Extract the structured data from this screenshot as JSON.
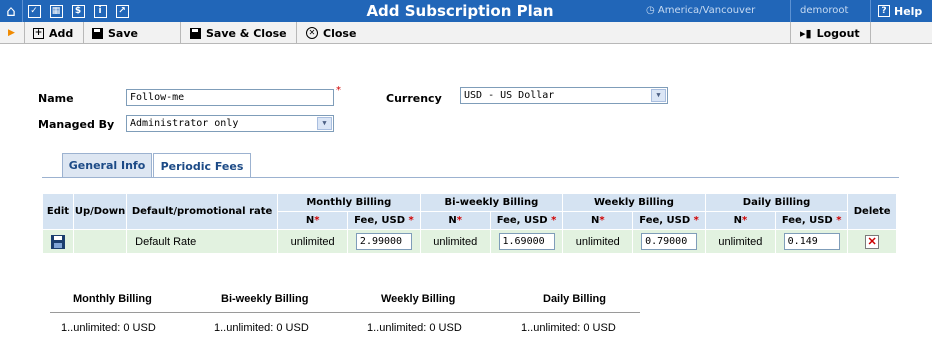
{
  "header": {
    "title": "Add Subscription Plan",
    "timezone": "America/Vancouver",
    "user": "demoroot",
    "help_label": "Help",
    "icons": [
      "home-icon",
      "checkbox-icon",
      "grid-icon",
      "dollar-icon",
      "info-icon",
      "chart-icon"
    ],
    "background_color": "#2166b8"
  },
  "toolbar": {
    "add_label": "Add",
    "save_label": "Save",
    "save_close_label": "Save & Close",
    "close_label": "Close",
    "logout_label": "Logout"
  },
  "form": {
    "name_label": "Name",
    "name_value": "Follow-me",
    "required_mark": "*",
    "currency_label": "Currency",
    "currency_value": "USD - US Dollar",
    "managed_by_label": "Managed By",
    "managed_by_value": "Administrator only"
  },
  "tabs": [
    {
      "label": "General Info",
      "active": false
    },
    {
      "label": "Periodic Fees",
      "active": true
    }
  ],
  "fees_table": {
    "headers": {
      "edit": "Edit",
      "up_down": "Up/Down",
      "rate": "Default/promotional rate",
      "monthly": "Monthly Billing",
      "biweekly": "Bi-weekly Billing",
      "weekly": "Weekly Billing",
      "daily": "Daily Billing",
      "delete": "Delete",
      "n": "N",
      "fee": "Fee, USD",
      "star": "*"
    },
    "row": {
      "rate_name": "Default Rate",
      "monthly_n": "unlimited",
      "monthly_fee": "2.99000",
      "biweekly_n": "unlimited",
      "biweekly_fee": "1.69000",
      "weekly_n": "unlimited",
      "weekly_fee": "0.79000",
      "daily_n": "unlimited",
      "daily_fee": "0.149"
    },
    "header_color": "#d5e3f2",
    "row_color": "#e2f2e0"
  },
  "summary": {
    "headers": [
      "Monthly Billing",
      "Bi-weekly Billing",
      "Weekly Billing",
      "Daily Billing"
    ],
    "values": [
      "1..unlimited: 0 USD",
      "1..unlimited: 0 USD",
      "1..unlimited: 0 USD",
      "1..unlimited: 0 USD"
    ]
  }
}
